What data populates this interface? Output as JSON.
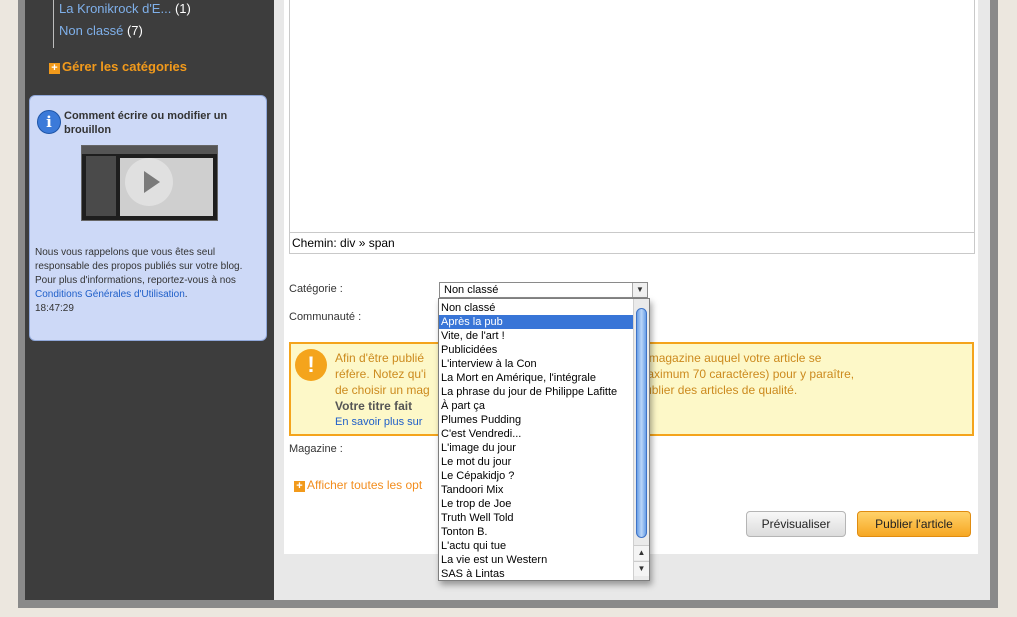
{
  "sidebar": {
    "categories": [
      {
        "label": "La Kronikrock d'E...",
        "count": "(1)"
      },
      {
        "label": "Non classé",
        "count": "(7)"
      }
    ],
    "manage_label": "Gérer les catégories",
    "help": {
      "title": "Comment écrire ou modifier un brouillon",
      "text1": "Nous vous rappelons que vous êtes seul responsable des propos publiés sur votre blog.",
      "text2": "Pour plus d'informations, reportez-vous à nos ",
      "link": "Conditions Générales d'Utilisation",
      "text3": ".",
      "time": "18:47:29"
    }
  },
  "editor": {
    "path_label": "Chemin: div » span"
  },
  "form": {
    "category_label": "Catégorie :",
    "category_value": "Non classé",
    "community_label": "Communauté :",
    "magazine_label": "Magazine :",
    "more_options": "Afficher toutes les opt"
  },
  "warning": {
    "line1a": "Afin d'être publié",
    "line1b": "à préciser le magazine auquel votre article se",
    "line2a": "réfère. Notez qu'i",
    "line2b": "tre court (maximum 70 caractères) pour y paraître,",
    "line3a": "de choisir un mag",
    "line3b": ", et de publier des articles de qualité.",
    "strong": "Votre titre fait",
    "link": "En savoir plus sur"
  },
  "buttons": {
    "preview": "Prévisualiser",
    "publish": "Publier l'article"
  },
  "dropdown_options": [
    "Non classé",
    "Après la pub",
    "Vite, de l'art !",
    "Publicidées",
    "L'interview à la Con",
    "La Mort en Amérique, l'intégrale",
    "La phrase du jour de Philippe Lafitte",
    "À part ça",
    "Plumes Pudding",
    "C'est Vendredi...",
    "L'image du jour",
    "Le mot du jour",
    "Le Cépakidjo ?",
    "Tandoori Mix",
    "Le trop de Joe",
    "Truth Well Told",
    "Tonton B.",
    "L'actu qui tue",
    "La vie est un Western",
    "SAS à Lintas"
  ],
  "dropdown_selected_index": 1,
  "icons": {
    "info": "i",
    "warning": "!",
    "plus": "+",
    "down_arrow": "▼",
    "up_arrow": "▲"
  }
}
